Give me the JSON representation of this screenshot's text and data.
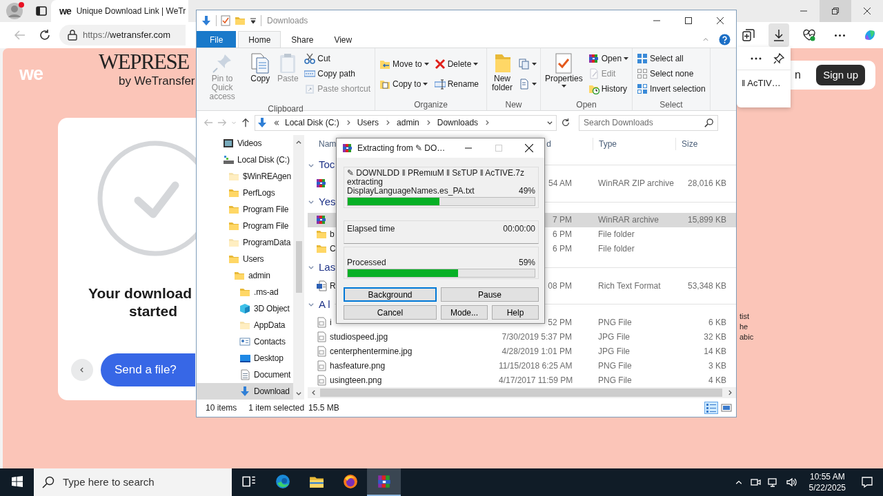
{
  "browser": {
    "tab_title": "Unique Download Link | WeTr",
    "favicon": "we",
    "url_scheme": "https://",
    "url_host": "wetransfer.com"
  },
  "page": {
    "brand": "we",
    "logo_title": "WEPRESE",
    "logo_subtitle": "by WeTransfer",
    "heading_lines": [
      "Your download",
      "started"
    ],
    "send_button": "Send a file?",
    "login_fragment": "n",
    "signup_button": "Sign up",
    "side_fragments": [
      "tist",
      "he",
      "abic"
    ]
  },
  "downloads_flyout": {
    "item_text": "‖ AcTIV…"
  },
  "explorer": {
    "title": "Downloads",
    "tabs": [
      {
        "label": "File",
        "kind": "menu",
        "selected": false
      },
      {
        "label": "Home",
        "kind": "tab",
        "selected": true
      },
      {
        "label": "Share",
        "kind": "tab",
        "selected": false
      },
      {
        "label": "View",
        "kind": "tab",
        "selected": false
      }
    ],
    "ribbon": [
      {
        "name": "Clipboard",
        "items": [
          {
            "label": "Pin to Quick access",
            "kind": "large",
            "disabled": true,
            "dropdown": false
          },
          {
            "label": "Copy",
            "kind": "large",
            "disabled": false,
            "dropdown": false
          },
          {
            "label": "Paste",
            "kind": "large",
            "disabled": true,
            "dropdown": false
          },
          {
            "label": "Cut",
            "kind": "small",
            "disabled": false,
            "dropdown": false
          },
          {
            "label": "Copy path",
            "kind": "small",
            "disabled": false,
            "dropdown": false
          },
          {
            "label": "Paste shortcut",
            "kind": "small",
            "disabled": true,
            "dropdown": false
          }
        ]
      },
      {
        "name": "Organize",
        "items": [
          {
            "label": "Move to",
            "kind": "small",
            "disabled": false,
            "dropdown": true
          },
          {
            "label": "Copy to",
            "kind": "small",
            "disabled": false,
            "dropdown": true
          },
          {
            "label": "Delete",
            "kind": "small",
            "disabled": false,
            "dropdown": true
          },
          {
            "label": "Rename",
            "kind": "small",
            "disabled": false,
            "dropdown": false
          }
        ]
      },
      {
        "name": "New",
        "items": [
          {
            "label": "New folder",
            "kind": "large",
            "disabled": false,
            "dropdown": false
          },
          {
            "kind": "small",
            "disabled": false,
            "dropdown": true
          },
          {
            "kind": "small",
            "disabled": false,
            "dropdown": true
          }
        ]
      },
      {
        "name": "Open",
        "items": [
          {
            "label": "Properties",
            "kind": "large",
            "disabled": false,
            "dropdown": true
          },
          {
            "label": "Open",
            "kind": "small",
            "disabled": false,
            "dropdown": true
          },
          {
            "label": "Edit",
            "kind": "small",
            "disabled": true,
            "dropdown": false
          },
          {
            "label": "History",
            "kind": "small",
            "disabled": false,
            "dropdown": false
          }
        ]
      },
      {
        "name": "Select",
        "items": [
          {
            "label": "Select all",
            "kind": "small",
            "disabled": false,
            "dropdown": false
          },
          {
            "label": "Select none",
            "kind": "small",
            "disabled": false,
            "dropdown": false
          },
          {
            "label": "Invert selection",
            "kind": "small",
            "disabled": false,
            "dropdown": false
          }
        ]
      }
    ],
    "address": {
      "crumbs": [
        "Local Disk (C:)",
        "Users",
        "admin",
        "Downloads"
      ],
      "search_placeholder": "Search Downloads"
    },
    "tree": [
      {
        "label": "Videos",
        "kind": "video",
        "hidden": false,
        "selected": false
      },
      {
        "label": "Local Disk (C:)",
        "kind": "drive",
        "hidden": false,
        "selected": false,
        "children": [
          {
            "label": "$WinREAgen",
            "kind": "folder",
            "hidden": true,
            "selected": false
          },
          {
            "label": "PerfLogs",
            "kind": "folder",
            "hidden": false,
            "selected": false
          },
          {
            "label": "Program File",
            "kind": "folder",
            "hidden": false,
            "selected": false
          },
          {
            "label": "Program File",
            "kind": "folder",
            "hidden": false,
            "selected": false
          },
          {
            "label": "ProgramData",
            "kind": "folder",
            "hidden": true,
            "selected": false
          },
          {
            "label": "Users",
            "kind": "folder",
            "hidden": false,
            "selected": false,
            "children": [
              {
                "label": "admin",
                "kind": "folder",
                "hidden": false,
                "selected": false,
                "children": [
                  {
                    "label": ".ms-ad",
                    "kind": "folder",
                    "hidden": false,
                    "selected": false
                  },
                  {
                    "label": "3D Object",
                    "kind": "objects",
                    "hidden": false,
                    "selected": false
                  },
                  {
                    "label": "AppData",
                    "kind": "folder",
                    "hidden": true,
                    "selected": false
                  },
                  {
                    "label": "Contacts",
                    "kind": "contacts",
                    "hidden": false,
                    "selected": false
                  },
                  {
                    "label": "Desktop",
                    "kind": "desktop",
                    "hidden": false,
                    "selected": false
                  },
                  {
                    "label": "Document",
                    "kind": "documents",
                    "hidden": false,
                    "selected": false
                  },
                  {
                    "label": "Download",
                    "kind": "downloads",
                    "hidden": false,
                    "selected": true
                  }
                ]
              }
            ]
          }
        ]
      }
    ],
    "columns": [
      {
        "label": "Nam"
      },
      {
        "label": "d"
      },
      {
        "label": "Type"
      },
      {
        "label": "Size"
      }
    ],
    "groups": [
      {
        "label": "Toc",
        "rows": [
          {
            "kind": "archive",
            "date": "54 AM",
            "type": "WinRAR ZIP archive",
            "size": "28,016 KB",
            "selected": false
          }
        ]
      },
      {
        "label": "Yes",
        "rows": [
          {
            "kind": "archive",
            "date": "7 PM",
            "type": "WinRAR archive",
            "size": "15,899 KB",
            "selected": true
          },
          {
            "kind": "folder",
            "name": "b",
            "date": "6 PM",
            "type": "File folder",
            "selected": false
          },
          {
            "kind": "folder",
            "name": "C",
            "date": "6 PM",
            "type": "File folder",
            "selected": false
          }
        ]
      },
      {
        "label": "Las",
        "rows": [
          {
            "kind": "word",
            "name": "R",
            "date": "08 PM",
            "type": "Rich Text Format",
            "size": "53,348 KB",
            "selected": false
          }
        ]
      },
      {
        "label": "A l",
        "rows": [
          {
            "kind": "image",
            "name": "i",
            "date": "52 PM",
            "type": "PNG File",
            "size": "6 KB",
            "selected": false
          },
          {
            "kind": "image",
            "name": "studiospeed.jpg",
            "date": "7/30/2019 5:37 PM",
            "type": "JPG File",
            "size": "32 KB",
            "selected": false
          },
          {
            "kind": "image",
            "name": "centerphentermine.jpg",
            "date": "4/28/2019 1:01 PM",
            "type": "JPG File",
            "size": "14 KB",
            "selected": false
          },
          {
            "kind": "image",
            "name": "hasfeature.png",
            "date": "11/15/2018 6:25 AM",
            "type": "PNG File",
            "size": "3 KB",
            "selected": false
          },
          {
            "kind": "image",
            "name": "usingteen.png",
            "date": "4/17/2017 11:59 PM",
            "type": "PNG File",
            "size": "4 KB",
            "selected": false
          }
        ]
      }
    ],
    "status": {
      "item_count": "10 items",
      "selection": "1 item selected",
      "size": "15.5 MB",
      "views": [
        {
          "selected": true
        },
        {
          "selected": false
        }
      ]
    }
  },
  "extract_dialog": {
    "title": "Extracting from ✎ DO…",
    "archive": "✎ DOWNⅬⅮⅮ ‖ PRemιuM ‖ SεTUP ‖ AcTIVE.7z",
    "action": "extracting",
    "file": "DisplayLanguageNames.es_PA.txt",
    "file_percent": "49%",
    "file_bar": {
      "level": 0.49
    },
    "elapsed_label": "Elapsed time",
    "elapsed": "00:00:00",
    "processed_label": "Processed",
    "processed_percent": "59%",
    "processed_bar": {
      "level": 0.59
    },
    "buttons": [
      {
        "label": "Background",
        "focused": true
      },
      {
        "label": "Pause",
        "focused": false
      },
      {
        "label": "Cancel",
        "focused": false
      },
      {
        "label": "Mode...",
        "focused": false
      },
      {
        "label": "Help",
        "focused": false
      }
    ]
  },
  "taskbar": {
    "search_placeholder": "Type here to search",
    "apps": [
      {
        "selected": false
      },
      {
        "selected": false
      },
      {
        "selected": false
      },
      {
        "selected": false
      },
      {
        "selected": true
      }
    ],
    "time": "10:55 AM",
    "date": "5/22/2025"
  }
}
